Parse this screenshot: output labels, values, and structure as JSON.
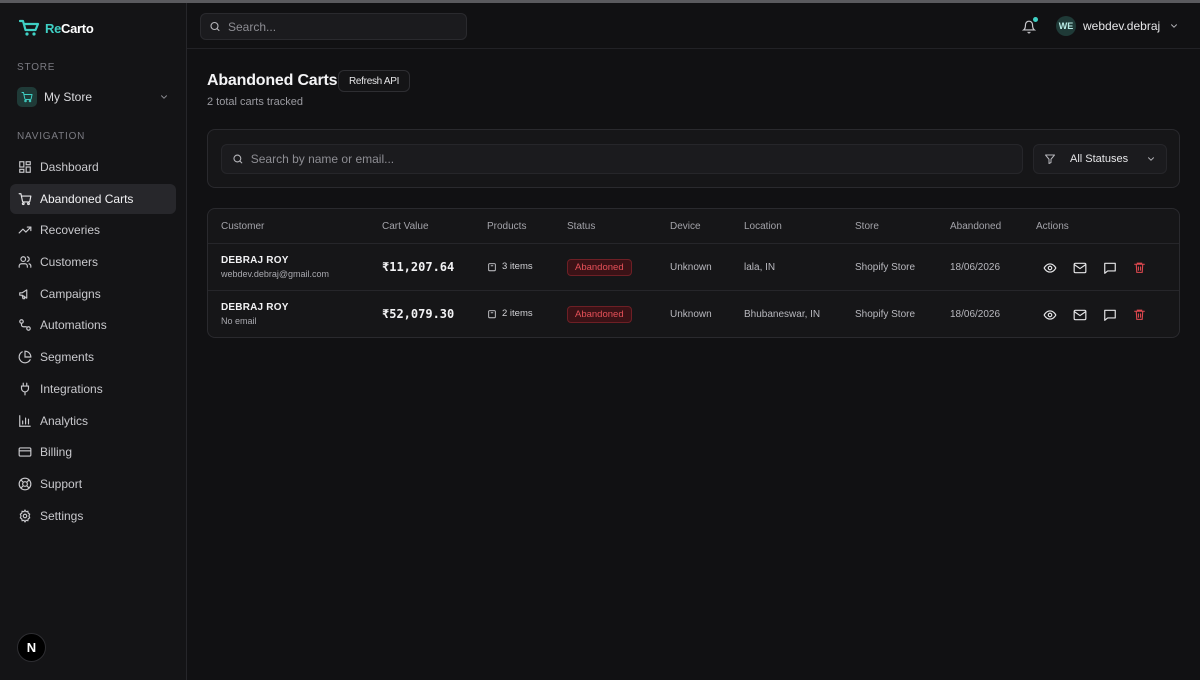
{
  "brand": {
    "name_part1": "Re",
    "name_part2": "Carto",
    "accent": "#3fd0c4"
  },
  "sidebar": {
    "store_section_label": "STORE",
    "store_name": "My Store",
    "nav_section_label": "NAVIGATION",
    "items": [
      {
        "label": "Dashboard",
        "icon": "dashboard-icon",
        "active": false
      },
      {
        "label": "Abandoned Carts",
        "icon": "cart-icon",
        "active": true
      },
      {
        "label": "Recoveries",
        "icon": "trending-up-icon",
        "active": false
      },
      {
        "label": "Customers",
        "icon": "users-icon",
        "active": false
      },
      {
        "label": "Campaigns",
        "icon": "megaphone-icon",
        "active": false
      },
      {
        "label": "Automations",
        "icon": "workflow-icon",
        "active": false
      },
      {
        "label": "Segments",
        "icon": "pie-chart-icon",
        "active": false
      },
      {
        "label": "Integrations",
        "icon": "plug-icon",
        "active": false
      },
      {
        "label": "Analytics",
        "icon": "bar-chart-icon",
        "active": false
      },
      {
        "label": "Billing",
        "icon": "credit-card-icon",
        "active": false
      },
      {
        "label": "Support",
        "icon": "lifebuoy-icon",
        "active": false
      },
      {
        "label": "Settings",
        "icon": "gear-icon",
        "active": false
      }
    ],
    "footer_badge": "N"
  },
  "header": {
    "search_placeholder": "Search...",
    "user_initials": "WE",
    "user_name": "webdev.debraj"
  },
  "page": {
    "title": "Abandoned Carts",
    "refresh_label": "Refresh API",
    "subtitle": "2 total carts tracked"
  },
  "filters": {
    "search_placeholder": "Search by name or email...",
    "status_value": "All Statuses"
  },
  "table": {
    "columns": [
      "Customer",
      "Cart Value",
      "Products",
      "Status",
      "Device",
      "Location",
      "Store",
      "Abandoned",
      "Actions"
    ],
    "rows": [
      {
        "name": "DEBRAJ ROY",
        "email": "webdev.debraj@gmail.com",
        "cart_value": "₹11,207.64",
        "products": "3 items",
        "status": "Abandoned",
        "device": "Unknown",
        "location": "lala, IN",
        "store": "Shopify Store",
        "abandoned": "18/06/2026"
      },
      {
        "name": "DEBRAJ ROY",
        "email": "No email",
        "cart_value": "₹52,079.30",
        "products": "2 items",
        "status": "Abandoned",
        "device": "Unknown",
        "location": "Bhubaneswar, IN",
        "store": "Shopify Store",
        "abandoned": "18/06/2026"
      }
    ]
  },
  "colors": {
    "background": "#111113",
    "status_abandoned": "#e55058",
    "delete_action": "#e0484f"
  }
}
